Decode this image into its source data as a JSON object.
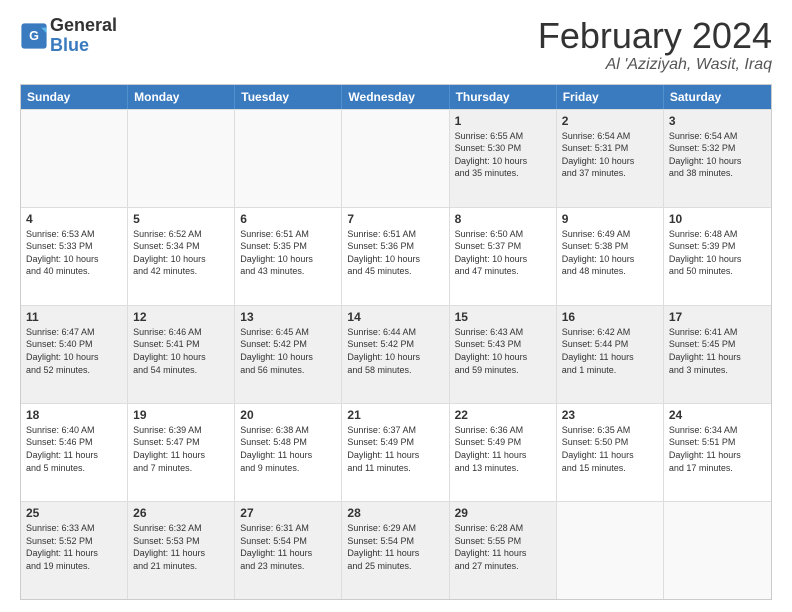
{
  "logo": {
    "line1": "General",
    "line2": "Blue"
  },
  "calendar": {
    "title": "February 2024",
    "subtitle": "Al 'Aziziyah, Wasit, Iraq",
    "headers": [
      "Sunday",
      "Monday",
      "Tuesday",
      "Wednesday",
      "Thursday",
      "Friday",
      "Saturday"
    ],
    "rows": [
      [
        {
          "day": "",
          "info": "",
          "empty": true
        },
        {
          "day": "",
          "info": "",
          "empty": true
        },
        {
          "day": "",
          "info": "",
          "empty": true
        },
        {
          "day": "",
          "info": "",
          "empty": true
        },
        {
          "day": "1",
          "info": "Sunrise: 6:55 AM\nSunset: 5:30 PM\nDaylight: 10 hours\nand 35 minutes."
        },
        {
          "day": "2",
          "info": "Sunrise: 6:54 AM\nSunset: 5:31 PM\nDaylight: 10 hours\nand 37 minutes."
        },
        {
          "day": "3",
          "info": "Sunrise: 6:54 AM\nSunset: 5:32 PM\nDaylight: 10 hours\nand 38 minutes."
        }
      ],
      [
        {
          "day": "4",
          "info": "Sunrise: 6:53 AM\nSunset: 5:33 PM\nDaylight: 10 hours\nand 40 minutes."
        },
        {
          "day": "5",
          "info": "Sunrise: 6:52 AM\nSunset: 5:34 PM\nDaylight: 10 hours\nand 42 minutes."
        },
        {
          "day": "6",
          "info": "Sunrise: 6:51 AM\nSunset: 5:35 PM\nDaylight: 10 hours\nand 43 minutes."
        },
        {
          "day": "7",
          "info": "Sunrise: 6:51 AM\nSunset: 5:36 PM\nDaylight: 10 hours\nand 45 minutes."
        },
        {
          "day": "8",
          "info": "Sunrise: 6:50 AM\nSunset: 5:37 PM\nDaylight: 10 hours\nand 47 minutes."
        },
        {
          "day": "9",
          "info": "Sunrise: 6:49 AM\nSunset: 5:38 PM\nDaylight: 10 hours\nand 48 minutes."
        },
        {
          "day": "10",
          "info": "Sunrise: 6:48 AM\nSunset: 5:39 PM\nDaylight: 10 hours\nand 50 minutes."
        }
      ],
      [
        {
          "day": "11",
          "info": "Sunrise: 6:47 AM\nSunset: 5:40 PM\nDaylight: 10 hours\nand 52 minutes."
        },
        {
          "day": "12",
          "info": "Sunrise: 6:46 AM\nSunset: 5:41 PM\nDaylight: 10 hours\nand 54 minutes."
        },
        {
          "day": "13",
          "info": "Sunrise: 6:45 AM\nSunset: 5:42 PM\nDaylight: 10 hours\nand 56 minutes."
        },
        {
          "day": "14",
          "info": "Sunrise: 6:44 AM\nSunset: 5:42 PM\nDaylight: 10 hours\nand 58 minutes."
        },
        {
          "day": "15",
          "info": "Sunrise: 6:43 AM\nSunset: 5:43 PM\nDaylight: 10 hours\nand 59 minutes."
        },
        {
          "day": "16",
          "info": "Sunrise: 6:42 AM\nSunset: 5:44 PM\nDaylight: 11 hours\nand 1 minute."
        },
        {
          "day": "17",
          "info": "Sunrise: 6:41 AM\nSunset: 5:45 PM\nDaylight: 11 hours\nand 3 minutes."
        }
      ],
      [
        {
          "day": "18",
          "info": "Sunrise: 6:40 AM\nSunset: 5:46 PM\nDaylight: 11 hours\nand 5 minutes."
        },
        {
          "day": "19",
          "info": "Sunrise: 6:39 AM\nSunset: 5:47 PM\nDaylight: 11 hours\nand 7 minutes."
        },
        {
          "day": "20",
          "info": "Sunrise: 6:38 AM\nSunset: 5:48 PM\nDaylight: 11 hours\nand 9 minutes."
        },
        {
          "day": "21",
          "info": "Sunrise: 6:37 AM\nSunset: 5:49 PM\nDaylight: 11 hours\nand 11 minutes."
        },
        {
          "day": "22",
          "info": "Sunrise: 6:36 AM\nSunset: 5:49 PM\nDaylight: 11 hours\nand 13 minutes."
        },
        {
          "day": "23",
          "info": "Sunrise: 6:35 AM\nSunset: 5:50 PM\nDaylight: 11 hours\nand 15 minutes."
        },
        {
          "day": "24",
          "info": "Sunrise: 6:34 AM\nSunset: 5:51 PM\nDaylight: 11 hours\nand 17 minutes."
        }
      ],
      [
        {
          "day": "25",
          "info": "Sunrise: 6:33 AM\nSunset: 5:52 PM\nDaylight: 11 hours\nand 19 minutes."
        },
        {
          "day": "26",
          "info": "Sunrise: 6:32 AM\nSunset: 5:53 PM\nDaylight: 11 hours\nand 21 minutes."
        },
        {
          "day": "27",
          "info": "Sunrise: 6:31 AM\nSunset: 5:54 PM\nDaylight: 11 hours\nand 23 minutes."
        },
        {
          "day": "28",
          "info": "Sunrise: 6:29 AM\nSunset: 5:54 PM\nDaylight: 11 hours\nand 25 minutes."
        },
        {
          "day": "29",
          "info": "Sunrise: 6:28 AM\nSunset: 5:55 PM\nDaylight: 11 hours\nand 27 minutes."
        },
        {
          "day": "",
          "info": "",
          "empty": true
        },
        {
          "day": "",
          "info": "",
          "empty": true
        }
      ]
    ]
  }
}
